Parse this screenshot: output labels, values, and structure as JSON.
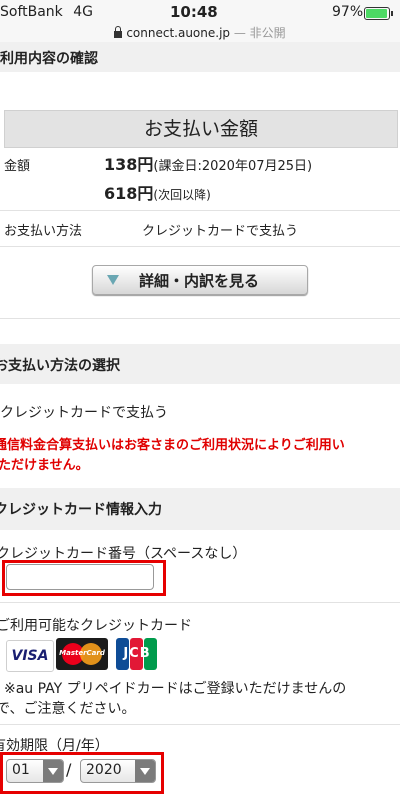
{
  "status_bar": {
    "carrier": "SoftBank",
    "network": "4G",
    "time": "10:48",
    "battery_percent": "97%",
    "battery_level": 0.97,
    "url": "connect.auone.jp",
    "url_note": "— 非公開"
  },
  "confirm_section": {
    "title": "ご利用内容の確認"
  },
  "payment_amount": {
    "header": "お支払い金額",
    "amount_label": "金額",
    "first_amount": "138円",
    "first_note": "(課金日:2020年07月25日)",
    "next_amount": "618円",
    "next_note": "(次回以降)",
    "method_label": "お支払い方法",
    "method_value": "クレジットカードで支払う",
    "detail_button": "詳細・内訳を見る"
  },
  "method_section": {
    "title": "お支払い方法の選択",
    "option_label": "クレジットカードで支払う",
    "warning_line1": "通信料金合算支払いはお客さまのご利用状況によりご利用い",
    "warning_line2": "ただけません。"
  },
  "card_section": {
    "title": "クレジットカード情報入力",
    "number_label": "クレジットカード番号（スペースなし）",
    "number_value": "",
    "available_label": "ご利用可能なクレジットカード",
    "brands": [
      "VISA",
      "MasterCard",
      "JCB"
    ],
    "note_line1": "※au PAY プリペイドカードはご登録いただけませんの",
    "note_line2": "で、ご注意ください。",
    "expiry_label": "有効期限（月/年）",
    "expiry_month": "01",
    "expiry_separator": "/",
    "expiry_year": "2020"
  },
  "colors": {
    "warning": "#e00000",
    "highlight_box": "#e60000",
    "section_bg": "#f0f0f0"
  }
}
